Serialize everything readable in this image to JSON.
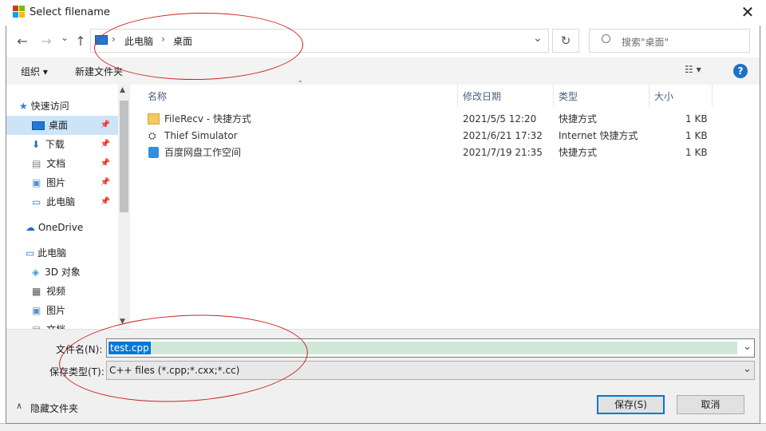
{
  "window": {
    "title": "Select filename",
    "close_glyph": "✕"
  },
  "nav": {
    "back_glyph": "←",
    "forward_glyph": "→",
    "recent_glyph": "⌄",
    "up_glyph": "↑",
    "breadcrumb": [
      "此电脑",
      "桌面"
    ],
    "breadcrumb_sep": "›",
    "dropdown_glyph": "⌄",
    "refresh_glyph": "↻",
    "search_placeholder": "搜索\"桌面\""
  },
  "toolbar": {
    "organize": "组织 ▾",
    "new_folder": "新建文件夹",
    "view_glyph": "☷ ▾",
    "help": "?"
  },
  "sidebar": {
    "items": [
      {
        "label": "快速访问",
        "icon": "star-icon"
      },
      {
        "label": "桌面",
        "icon": "desktop-icon",
        "pinned": true,
        "selected": true
      },
      {
        "label": "下载",
        "icon": "download-icon",
        "pinned": true
      },
      {
        "label": "文档",
        "icon": "document-icon",
        "pinned": true
      },
      {
        "label": "图片",
        "icon": "pictures-icon",
        "pinned": true
      },
      {
        "label": "此电脑",
        "icon": "computer-icon",
        "pinned": true
      },
      {
        "label": "OneDrive",
        "icon": "cloud-icon"
      },
      {
        "label": "此电脑",
        "icon": "computer-icon"
      },
      {
        "label": "3D 对象",
        "icon": "cube-icon"
      },
      {
        "label": "视频",
        "icon": "video-icon"
      },
      {
        "label": "图片",
        "icon": "pictures-icon"
      },
      {
        "label": "文档",
        "icon": "document-icon"
      }
    ],
    "pin_glyph": "📌"
  },
  "files": {
    "columns": [
      "名称",
      "修改日期",
      "类型",
      "大小"
    ],
    "rows": [
      {
        "name": "FileRecv - 快捷方式",
        "date": "2021/5/5 12:20",
        "type": "快捷方式",
        "size": "1 KB",
        "icon": "folder-shortcut-icon"
      },
      {
        "name": "Thief Simulator",
        "date": "2021/6/21 17:32",
        "type": "Internet 快捷方式",
        "size": "1 KB",
        "icon": "internet-shortcut-icon"
      },
      {
        "name": "百度网盘工作空间",
        "date": "2021/7/19 21:35",
        "type": "快捷方式",
        "size": "1 KB",
        "icon": "baidu-shortcut-icon"
      }
    ]
  },
  "form": {
    "filename_label": "文件名(N):",
    "filename_value": "test.cpp",
    "filetype_label": "保存类型(T):",
    "filetype_value": "C++ files (*.cpp;*.cxx;*.cc)"
  },
  "footer": {
    "hide_folders": "隐藏文件夹",
    "save": "保存(S)",
    "cancel": "取消"
  },
  "colors": {
    "selected": "#cce4f7",
    "highlight": "#0078d7",
    "annotation": "#d02020"
  }
}
